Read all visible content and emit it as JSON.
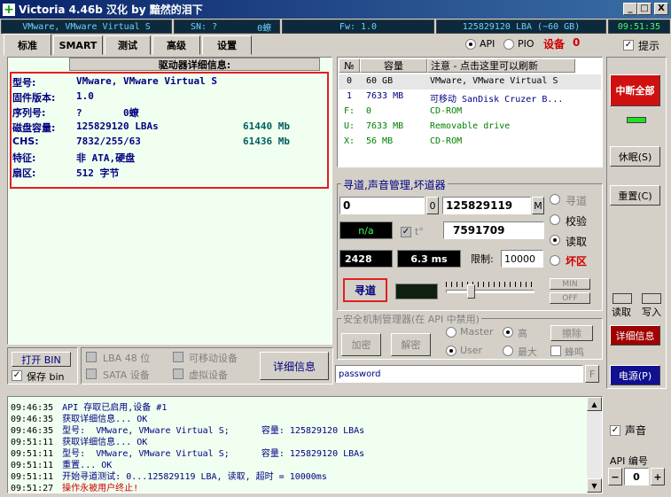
{
  "window": {
    "title": "Victoria 4.46b 汉化 by 黯然的泪下",
    "min": "_",
    "max": "□",
    "close": "X"
  },
  "status": {
    "model": "VMware, VMware Virtual S",
    "sn": "SN: ?",
    "sn_val": "0蟟",
    "fw": "Fw: 1.0",
    "lba": "125829120 LBA (~60 GB)",
    "time": "09:51:35"
  },
  "tabs": [
    {
      "label": "标准"
    },
    {
      "label": "SMART"
    },
    {
      "label": "测试"
    },
    {
      "label": "高级"
    },
    {
      "label": "设置"
    }
  ],
  "mode": {
    "api": "API",
    "pio": "PIO",
    "device_label": "设备",
    "device_num": "0",
    "hint": "提示"
  },
  "info": {
    "header": "驱动器详细信息:",
    "rows": [
      {
        "key": "型号:",
        "val": "VMware, VMware Virtual S",
        "extra": ""
      },
      {
        "key": "固件版本:",
        "val": "1.0",
        "extra": ""
      },
      {
        "key": "序列号:",
        "val": "?       0蟟",
        "extra": ""
      },
      {
        "key": "磁盘容量:",
        "val": "125829120 LBAs",
        "extra": "61440 Mb"
      },
      {
        "key": "CHS:",
        "val": "7832/255/63",
        "extra": "61436 Mb"
      },
      {
        "key": "特征:",
        "val": "非 ATA,硬盘",
        "extra": ""
      },
      {
        "key": "扇区:",
        "val": "512 字节",
        "extra": ""
      }
    ]
  },
  "drives": {
    "headers": [
      "№",
      "容量",
      "注意 - 点击这里可以刷新"
    ],
    "rows": [
      {
        "n": "0",
        "cap": "60 GB",
        "note": "VMware, VMware Virtual S",
        "color": "#000000"
      },
      {
        "n": "1",
        "cap": "7633 MB",
        "note": "可移动 SanDisk Cruzer B...",
        "color": "#000080"
      },
      {
        "n": "F:",
        "cap": "0",
        "note": "CD-ROM",
        "color": "#008000"
      },
      {
        "n": "U:",
        "cap": "7633 MB",
        "note": "Removable drive",
        "color": "#008000"
      },
      {
        "n": "X:",
        "cap": "56 MB",
        "note": "CD-ROM",
        "color": "#008000"
      }
    ]
  },
  "seek": {
    "title": "寻道,声音管理,坏道器",
    "start": "0",
    "start_btn": "0",
    "end": "125829119",
    "end_btn": "M",
    "na": "n/a",
    "t_label": "t°",
    "cur": "7591709",
    "v1": "2428",
    "v2": "6.3 ms",
    "limit_label": "限制:",
    "limit": "10000",
    "seek_btn": "寻道",
    "min_btn": "MIN",
    "off_btn": "OFF",
    "modes": [
      "寻道",
      "校验",
      "读取",
      "坏区"
    ]
  },
  "security": {
    "title": "安全机制管理器(在 API 中禁用)",
    "encrypt": "加密",
    "decrypt": "解密",
    "erase": "擦除",
    "master": "Master",
    "user": "User",
    "high": "高",
    "max": "最大",
    "erase_chk": "蜂鸣",
    "password": "password",
    "f_btn": "F"
  },
  "bottom": {
    "open_bin": "打开 BIN",
    "save_bin": "保存 bin",
    "lba48": "LBA 48 位",
    "sata": "SATA 设备",
    "removable": "可移动设备",
    "virtual": "虚拟设备",
    "detail_btn": "详细信息"
  },
  "side": {
    "break_all": "中断全部",
    "sleep": "休眠(S)",
    "reset": "重置(C)",
    "read": "读取",
    "write": "写入",
    "detail": "详细信息",
    "power": "电源(P)",
    "sound": "声音",
    "api_num_label": "API 编号",
    "api_num": "0",
    "minus": "−",
    "plus": "+"
  },
  "log": [
    {
      "t": "09:46:35",
      "msg": "API 存取已启用,设备 #1",
      "color": "#000080"
    },
    {
      "t": "09:46:35",
      "msg": "获取详细信息... OK",
      "color": "#000080"
    },
    {
      "t": "09:46:35",
      "msg": "型号:  VMware, VMware Virtual S;      容量: 125829120 LBAs",
      "color": "#000080"
    },
    {
      "t": "09:51:11",
      "msg": "获取详细信息... OK",
      "color": "#000080"
    },
    {
      "t": "09:51:11",
      "msg": "型号:  VMware, VMware Virtual S;      容量: 125829120 LBAs",
      "color": "#000080"
    },
    {
      "t": "09:51:11",
      "msg": "重置... OK",
      "color": "#000080"
    },
    {
      "t": "09:51:11",
      "msg": "开始寻道测试: 0...125829119 LBA, 读取, 超时 = 10000ms",
      "color": "#000080"
    },
    {
      "t": "09:51:27",
      "msg": "操作永被用户终止!",
      "color": "#cc0000"
    }
  ]
}
